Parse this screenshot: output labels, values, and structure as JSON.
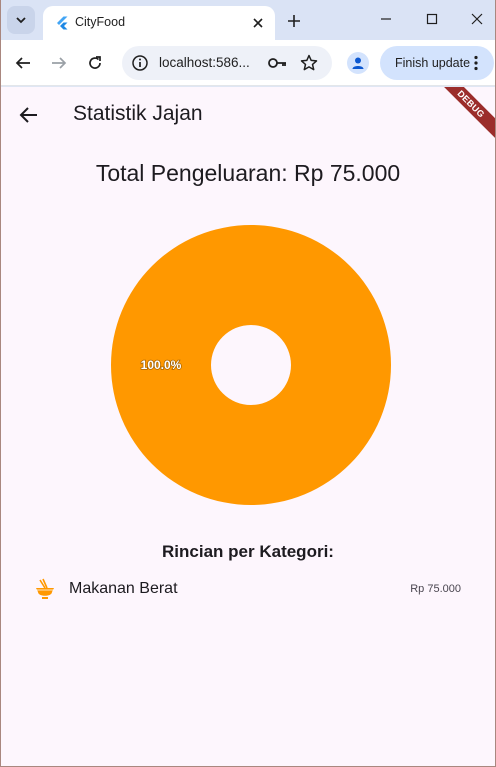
{
  "browser": {
    "tab_title": "CityFood",
    "url": "localhost:586...",
    "update_label": "Finish update",
    "colors": {
      "tabstrip": "#dae3f5",
      "update_button": "#d3e3fd"
    }
  },
  "app": {
    "title": "Statistik Jajan",
    "debug_label": "DEBUG",
    "total_label": "Total Pengeluaran: Rp 75.000",
    "section_title": "Rincian per Kategori:",
    "categories": [
      {
        "name": "Makanan Berat",
        "amount": "Rp 75.000",
        "icon": "noodle-bowl-icon",
        "color": "#ff9800"
      }
    ],
    "accent": "#ff9800"
  },
  "chart_data": {
    "type": "pie",
    "variant": "donut",
    "slices": [
      {
        "label": "100.0%",
        "value": 100,
        "color": "#ff9800"
      }
    ]
  }
}
